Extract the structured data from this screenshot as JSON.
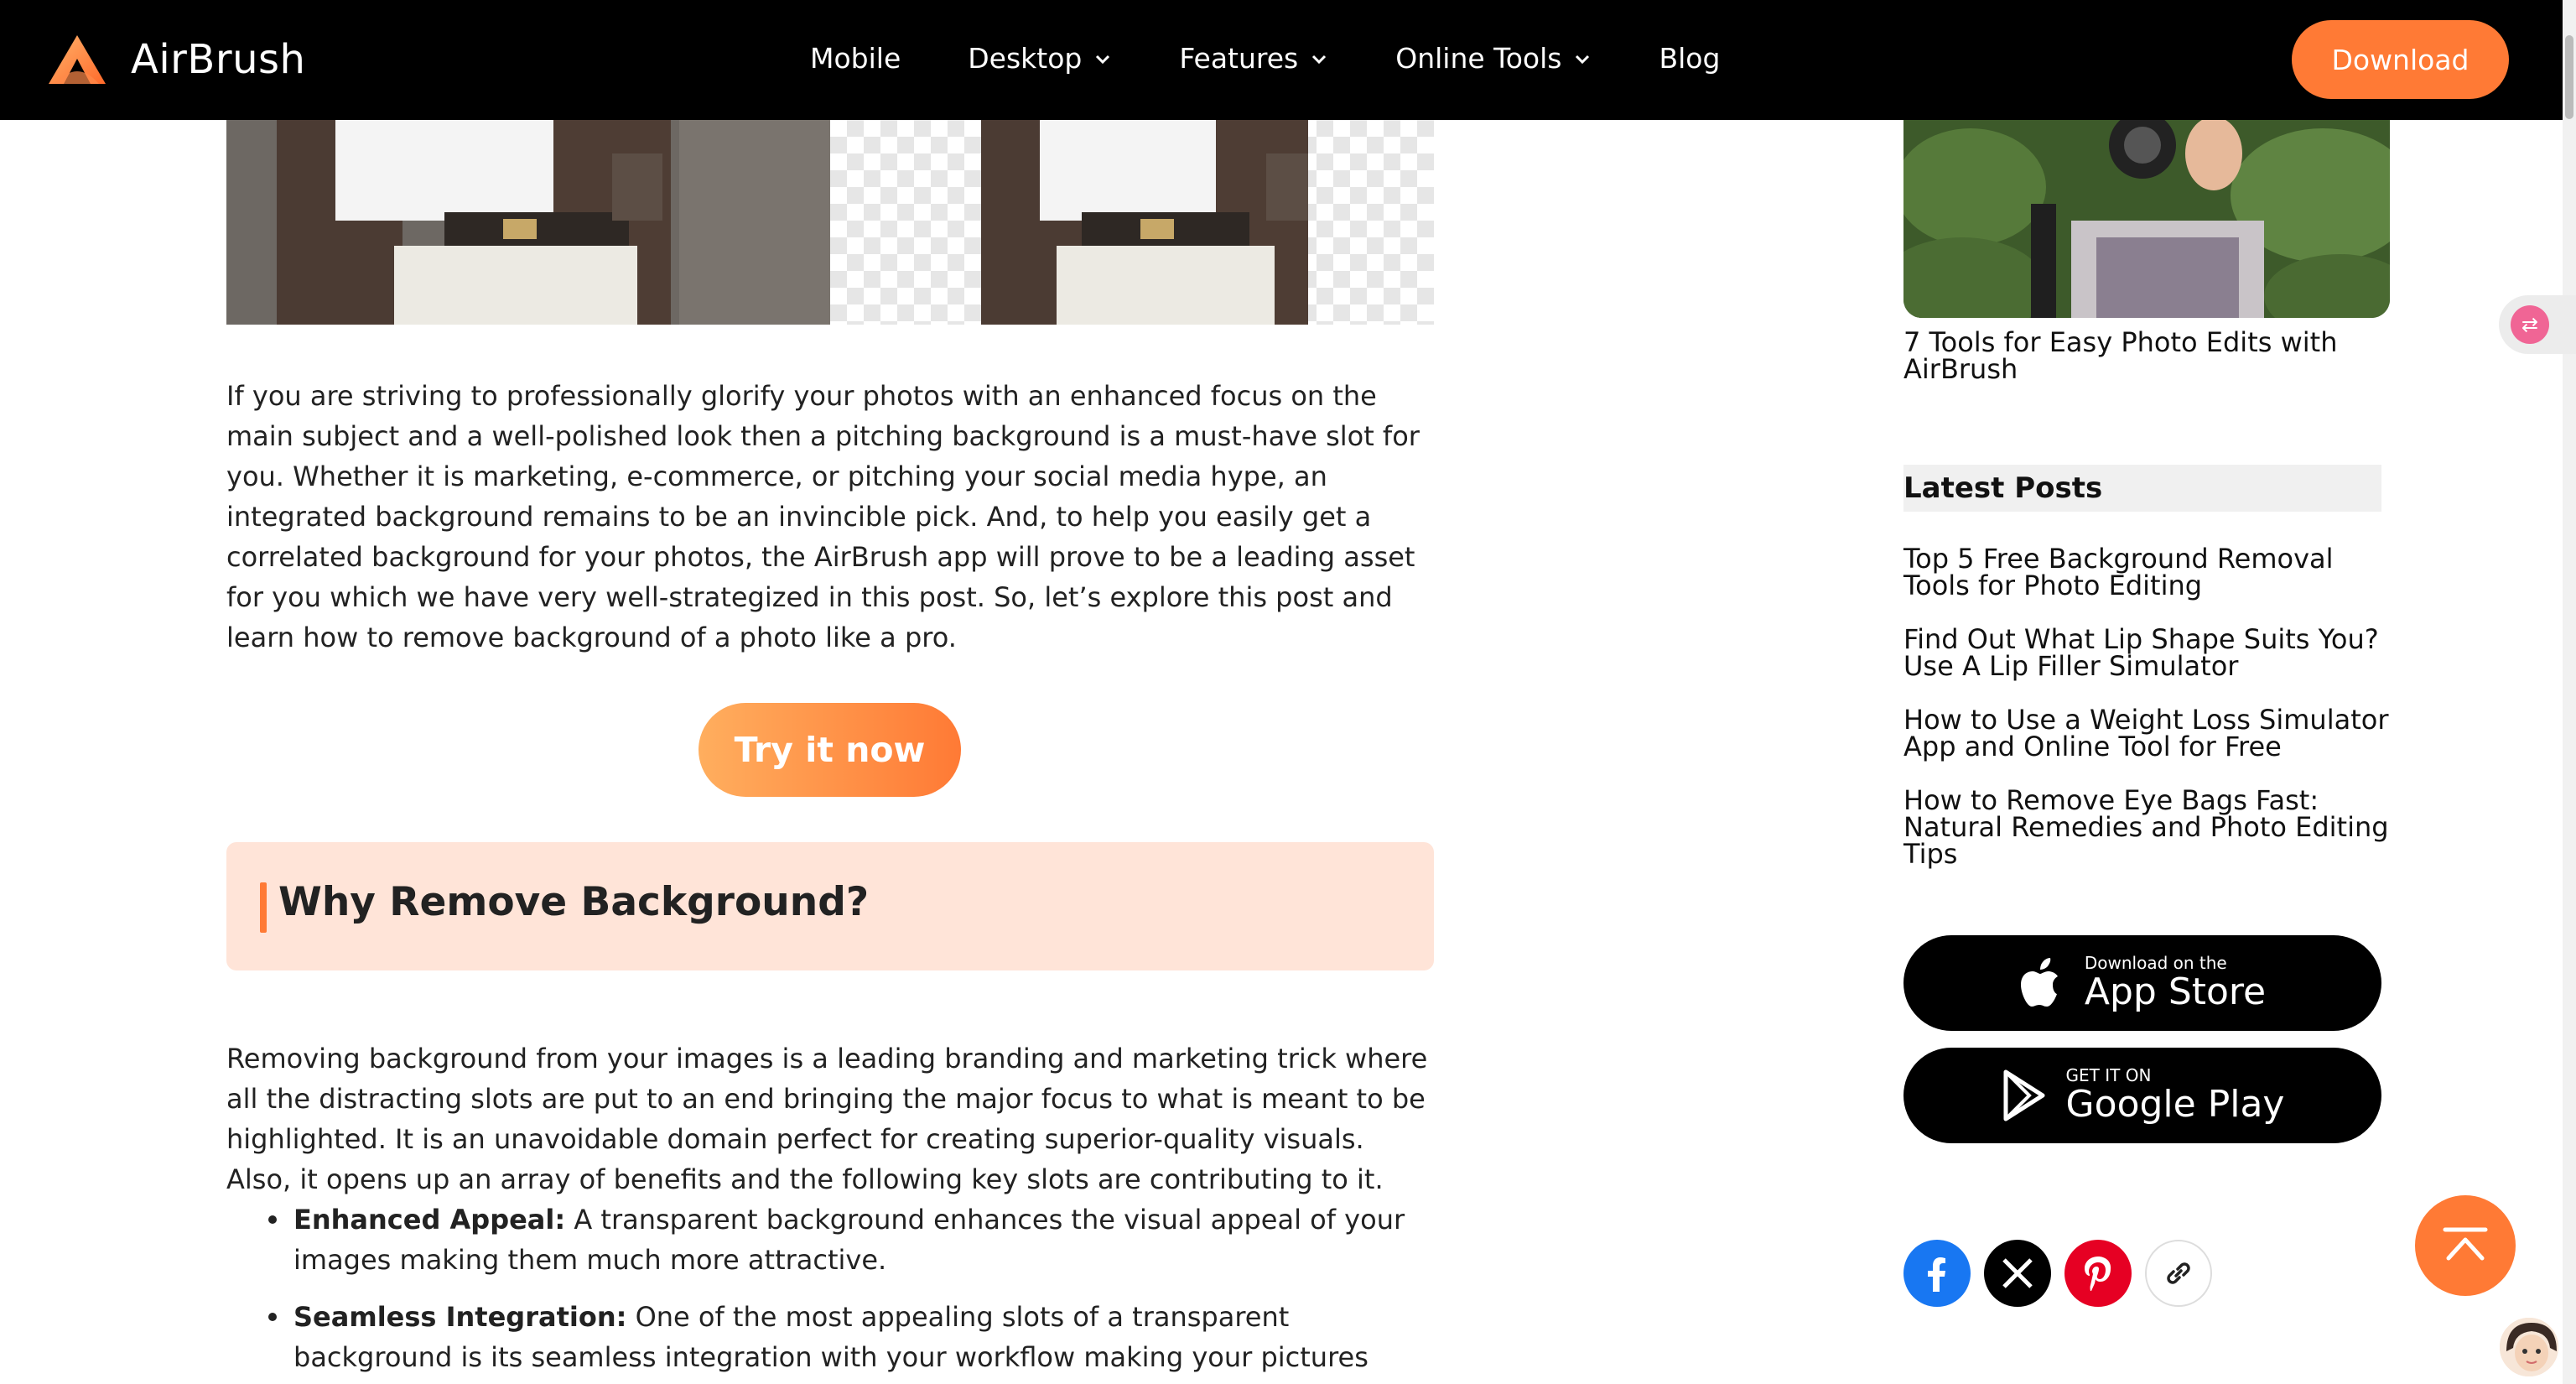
{
  "nav": {
    "brand": "AirBrush",
    "items": [
      {
        "label": "Mobile",
        "dropdown": false
      },
      {
        "label": "Desktop",
        "dropdown": true
      },
      {
        "label": "Features",
        "dropdown": true
      },
      {
        "label": "Online Tools",
        "dropdown": true
      },
      {
        "label": "Blog",
        "dropdown": false
      }
    ],
    "download_label": "Download"
  },
  "article": {
    "intro": "If you are striving to professionally glorify your photos with an enhanced focus on the main subject and a well-polished look then a pitching background is a must-have slot for you. Whether it is marketing, e-commerce, or pitching your social media hype, an integrated background remains to be an invincible pick. And, to help you easily get a correlated background for your photos, the AirBrush app will prove to be a leading asset for you which we have very well-strategized in this post. So, let’s explore this post and learn how to remove background of a photo like a pro.",
    "cta_label": "Try it now",
    "section_title": "Why Remove Background?",
    "section_body": "Removing background from your images is a leading branding and marketing trick where all the distracting slots are put to an end bringing the major focus to what is meant to be highlighted. It is an unavoidable domain perfect for creating superior-quality visuals. Also, it opens up an array of benefits and the following key slots are contributing to it.",
    "bullets": [
      {
        "title": "Enhanced Appeal:",
        "text": " A transparent background enhances the visual appeal of your images making them much more attractive."
      },
      {
        "title": "Seamless Integration:",
        "text": " One of the most appealing slots of a transparent background is its seamless integration with your workflow making your pictures appeal much"
      }
    ]
  },
  "sidebar": {
    "featured_caption": "7 Tools for Easy Photo Edits with AirBrush",
    "latest_heading": "Latest Posts",
    "latest_posts": [
      "Top 5 Free Background Removal Tools for Photo Editing",
      "Find Out What Lip Shape Suits You? Use A Lip Filler Simulator",
      "How to Use a Weight Loss Simulator App and Online Tool for Free",
      "How to Remove Eye Bags Fast: Natural Remedies and Photo Editing Tips"
    ],
    "app_store": {
      "small": "Download on the",
      "big": "App Store"
    },
    "google_play": {
      "small": "GET IT ON",
      "big": "Google Play"
    },
    "socials": [
      "facebook-icon",
      "x-icon",
      "pinterest-icon",
      "link-icon"
    ]
  },
  "colors": {
    "accent": "#ff7a35",
    "callout_bg": "#ffe4d8",
    "nav_bg": "#000000"
  }
}
